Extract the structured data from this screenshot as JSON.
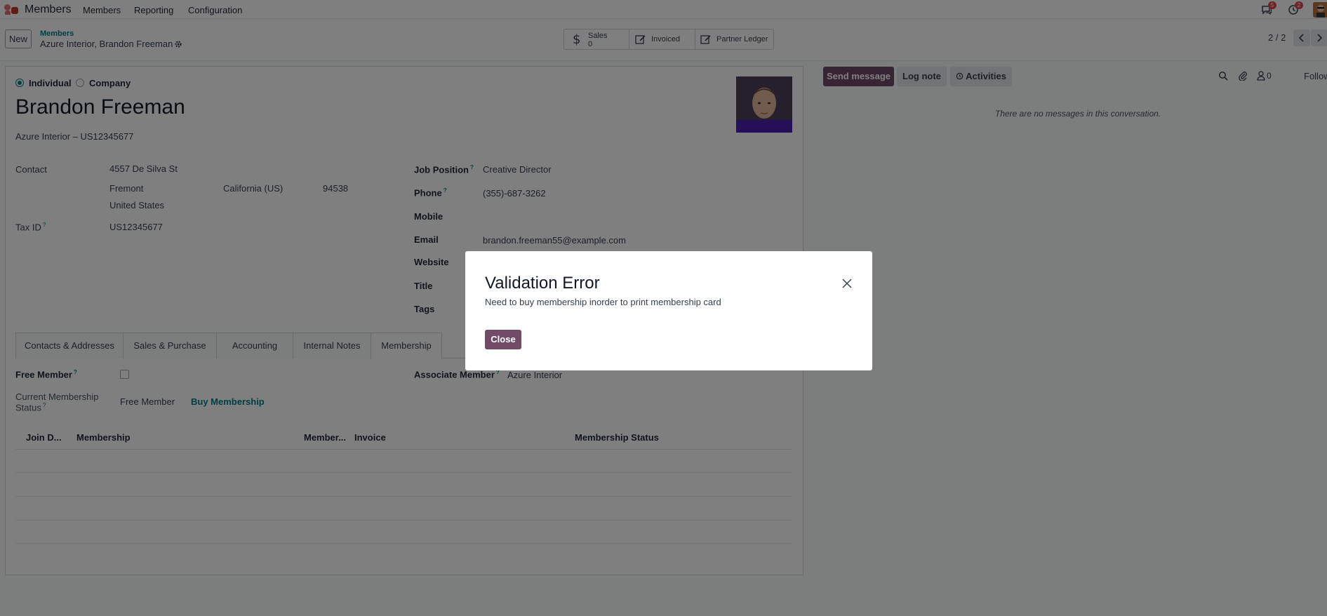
{
  "navbar": {
    "app_name": "Members",
    "menu": [
      "Members",
      "Reporting",
      "Configuration"
    ],
    "messages_badge": "5",
    "activities_badge": "2"
  },
  "control": {
    "new_label": "New",
    "breadcrumb_parent": "Members",
    "breadcrumb_current": "Azure Interior, Brandon Freeman",
    "smart_buttons": {
      "sales_label": "Sales",
      "sales_count": "0",
      "invoiced_label": "Invoiced",
      "ledger_label": "Partner Ledger"
    },
    "pager": "2 / 2"
  },
  "form": {
    "type_individual": "Individual",
    "type_company": "Company",
    "name": "Brandon Freeman",
    "company_line": "Azure Interior – US12345677",
    "contact_label": "Contact",
    "street": "4557 De Silva St",
    "city": "Fremont",
    "state": "California (US)",
    "zip": "94538",
    "country": "United States",
    "tax_id_label": "Tax ID",
    "tax_id": "US12345677",
    "job_position_label": "Job Position",
    "job_position": "Creative Director",
    "phone_label": "Phone",
    "phone": "(355)-687-3262",
    "mobile_label": "Mobile",
    "email_label": "Email",
    "email": "brandon.freeman55@example.com",
    "website_label": "Website",
    "title_label": "Title",
    "tags_label": "Tags",
    "help_mark": "?"
  },
  "tabs": [
    "Contacts & Addresses",
    "Sales & Purchase",
    "Accounting",
    "Internal Notes",
    "Membership"
  ],
  "membership": {
    "free_member_label": "Free Member",
    "current_status_label_1": "Current Membership",
    "current_status_label_2": "Status",
    "current_status": "Free Member",
    "buy_link": "Buy Membership",
    "associate_label": "Associate Member",
    "associate_value": "Azure Interior",
    "columns": [
      "Join D...",
      "Membership",
      "Member...",
      "Invoice",
      "Membership Status"
    ]
  },
  "chatter": {
    "send_message": "Send message",
    "log_note": "Log note",
    "activities": "Activities",
    "followers_count": "0",
    "follow_label": "Follow",
    "empty_text": "There are no messages in this conversation."
  },
  "modal": {
    "title": "Validation Error",
    "body": "Need to buy membership inorder to print membership card",
    "close_label": "Close"
  }
}
